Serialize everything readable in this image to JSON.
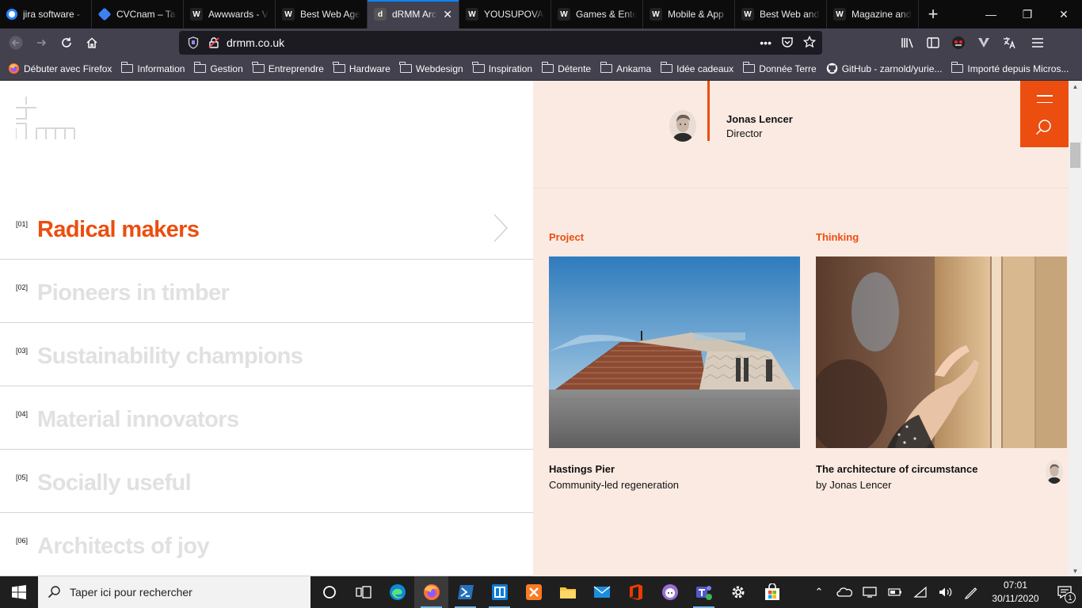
{
  "browser": {
    "tabs": [
      {
        "title": "jira software -",
        "icon": "jira-icon",
        "color": "#2684ff"
      },
      {
        "title": "CVCnam – Ta",
        "icon": "diamond-icon",
        "color": "#3b82f6"
      },
      {
        "title": "Awwwards - V",
        "icon": "awwwards-icon",
        "color": "#222222"
      },
      {
        "title": "Best Web Age",
        "icon": "awwwards-icon",
        "color": "#222222"
      },
      {
        "title": "dRMM Arc",
        "icon": "drmm-icon",
        "color": "#555555"
      },
      {
        "title": "YOUSUPOVA",
        "icon": "awwwards-icon",
        "color": "#222222"
      },
      {
        "title": "Games & Ente",
        "icon": "awwwards-icon",
        "color": "#222222"
      },
      {
        "title": "Mobile & App",
        "icon": "awwwards-icon",
        "color": "#222222"
      },
      {
        "title": "Best Web and",
        "icon": "awwwards-icon",
        "color": "#222222"
      },
      {
        "title": "Magazine and",
        "icon": "awwwards-icon",
        "color": "#222222"
      }
    ],
    "url": "drmm.co.uk",
    "bookmarks": [
      {
        "label": "Débuter avec Firefox",
        "type": "firefox"
      },
      {
        "label": "Information",
        "type": "folder"
      },
      {
        "label": "Gestion",
        "type": "folder"
      },
      {
        "label": "Entreprendre",
        "type": "folder"
      },
      {
        "label": "Hardware",
        "type": "folder"
      },
      {
        "label": "Webdesign",
        "type": "folder"
      },
      {
        "label": "Inspiration",
        "type": "folder"
      },
      {
        "label": "Détente",
        "type": "folder"
      },
      {
        "label": "Ankama",
        "type": "folder"
      },
      {
        "label": "Idée cadeaux",
        "type": "folder"
      },
      {
        "label": "Donnée Terre",
        "type": "folder"
      },
      {
        "label": "GitHub - zarnold/yurie...",
        "type": "github"
      },
      {
        "label": "Importé depuis Micros...",
        "type": "folder"
      }
    ]
  },
  "menu": {
    "items": [
      {
        "num": "[01]",
        "label": "Radical makers"
      },
      {
        "num": "[02]",
        "label": "Pioneers in timber"
      },
      {
        "num": "[03]",
        "label": "Sustainability champions"
      },
      {
        "num": "[04]",
        "label": "Material innovators"
      },
      {
        "num": "[05]",
        "label": "Socially useful"
      },
      {
        "num": "[06]",
        "label": "Architects of joy"
      }
    ]
  },
  "person": {
    "name": "Jonas Lencer",
    "role": "Director"
  },
  "cards": [
    {
      "section": "Project",
      "title": "Hastings Pier",
      "subtitle": "Community-led regeneration"
    },
    {
      "section": "Thinking",
      "title": "The architecture of circumstance",
      "subtitle": "by Jonas Lencer"
    }
  ],
  "taskbar": {
    "search_placeholder": "Taper ici pour rechercher",
    "time": "07:01",
    "date": "30/11/2020",
    "notifications": "1"
  },
  "colors": {
    "accent": "#ec4e0f",
    "panel": "#fbeae2"
  }
}
